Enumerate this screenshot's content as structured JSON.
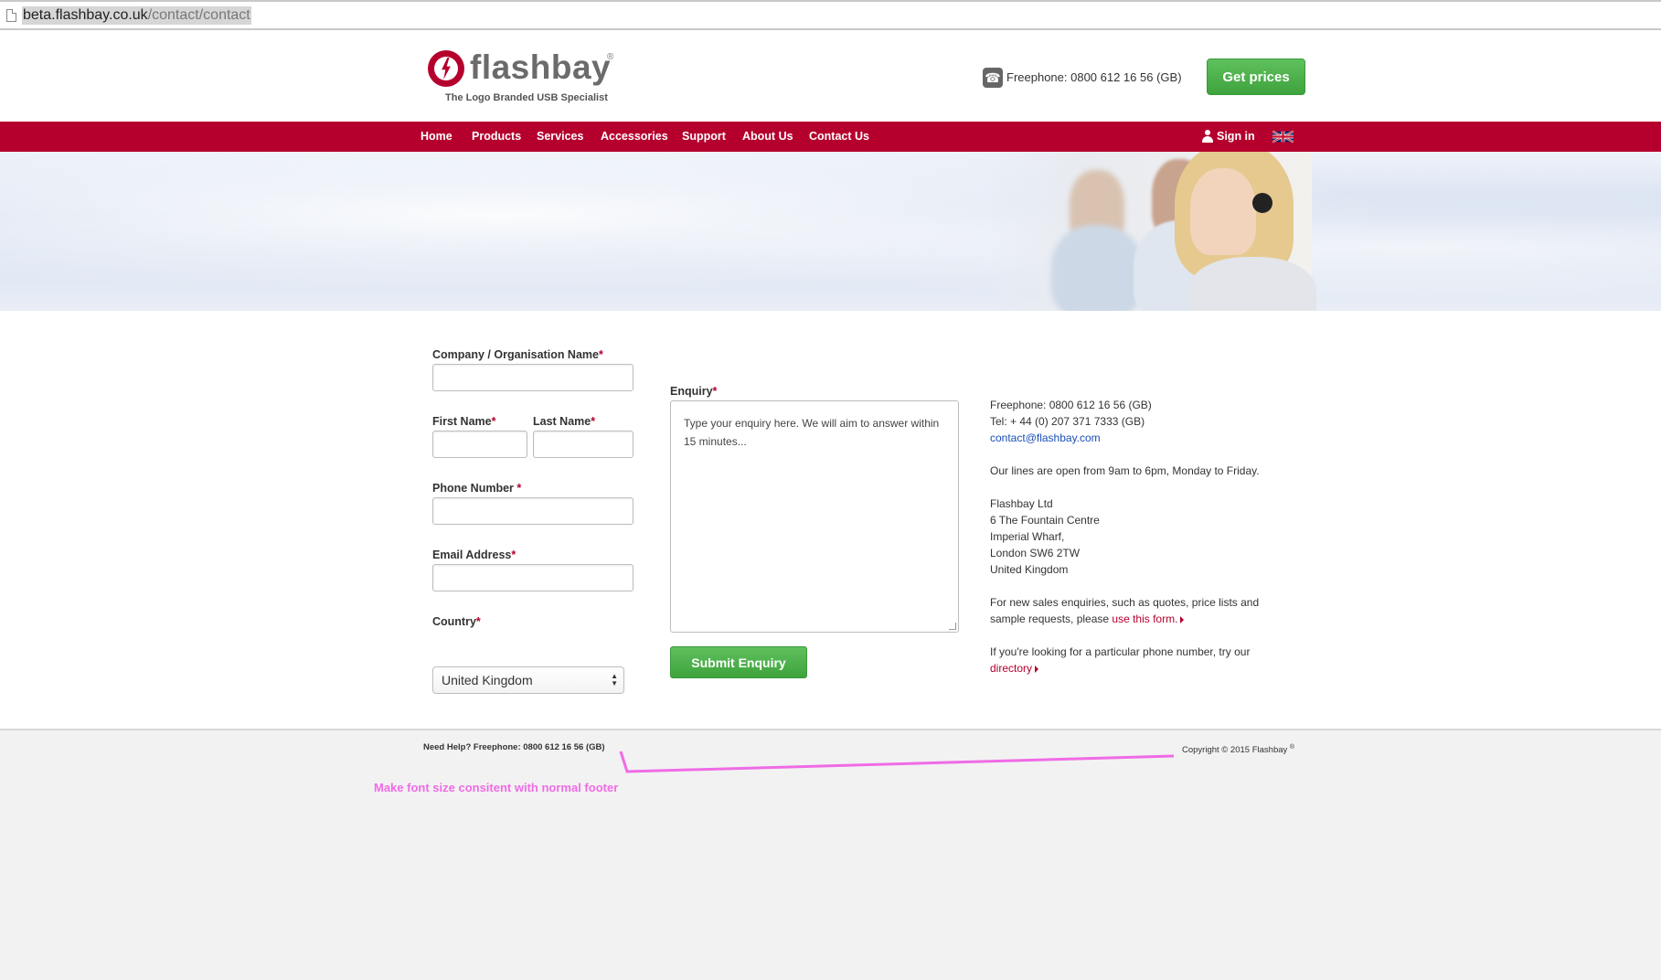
{
  "browser": {
    "url_host": "beta.flashbay.co.uk",
    "url_path": "/contact/contact"
  },
  "header": {
    "logo_text": "flashbay",
    "logo_reg": "®",
    "tagline": "The Logo Branded USB Specialist",
    "phone": "Freephone: 0800 612 16 56 (GB)",
    "get_prices": "Get prices"
  },
  "nav": {
    "items": [
      "Home",
      "Products",
      "Services",
      "Accessories",
      "Support",
      "About Us",
      "Contact Us"
    ],
    "sign_in": "Sign in"
  },
  "form": {
    "company_label": "Company / Organisation Name",
    "first_name_label": "First Name",
    "last_name_label": "Last Name",
    "phone_label": "Phone Number ",
    "email_label": "Email Address",
    "country_label": "Country",
    "country_value": "United Kingdom",
    "enquiry_label": "Enquiry",
    "enquiry_placeholder": "Type your enquiry here. We will aim to answer within 15 minutes...",
    "required_mark": "*",
    "submit": "Submit Enquiry"
  },
  "contact_info": {
    "freephone": "Freephone: 0800 612 16 56 (GB)",
    "tel": "Tel: + 44 (0) 207 371 7333 (GB)",
    "email": "contact@flashbay.com",
    "hours": "Our lines are open from 9am to 6pm, Monday to Friday.",
    "address": [
      "Flashbay Ltd",
      "6 The Fountain Centre",
      "Imperial Wharf,",
      "London SW6 2TW",
      "United Kingdom"
    ],
    "sales_text_1": "For new sales enquiries, such as quotes, price lists and",
    "sales_text_2": "sample requests, please ",
    "sales_link": "use this form.",
    "directory_text": "If you're looking for a particular phone number, try our",
    "directory_link": "directory"
  },
  "footer": {
    "help": "Need Help? Freephone: 0800 612 16 56 (GB)",
    "copyright": "Copyright © 2015 Flashbay",
    "copyright_reg": "®"
  },
  "annotation": {
    "note": "Make font size consitent with normal footer",
    "color": "#f06be6"
  },
  "colors": {
    "brand_red": "#b5002d",
    "button_green": "#4cb14a"
  }
}
